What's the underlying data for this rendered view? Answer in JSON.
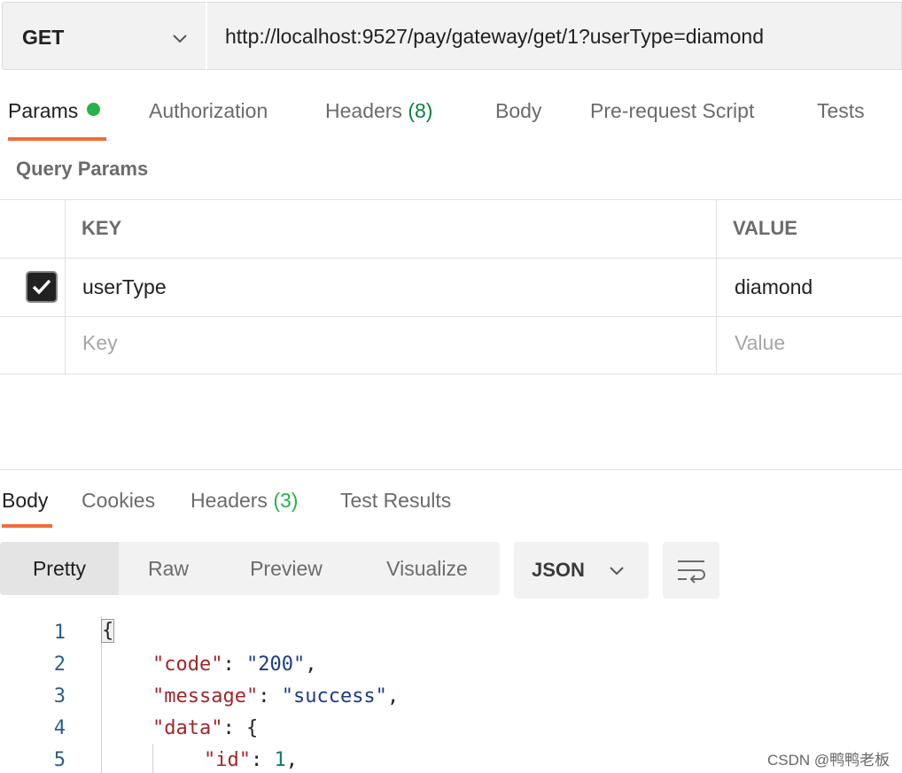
{
  "request": {
    "method": "GET",
    "url": "http://localhost:9527/pay/gateway/get/1?userType=diamond"
  },
  "request_tabs": [
    {
      "label": "Params",
      "active": true,
      "has_dot": true
    },
    {
      "label": "Authorization"
    },
    {
      "label": "Headers",
      "count": "(8)"
    },
    {
      "label": "Body"
    },
    {
      "label": "Pre-request Script"
    },
    {
      "label": "Tests"
    }
  ],
  "query_params": {
    "title": "Query Params",
    "columns": {
      "key": "KEY",
      "value": "VALUE"
    },
    "rows": [
      {
        "checked": true,
        "key": "userType",
        "value": "diamond"
      }
    ],
    "placeholder": {
      "key": "Key",
      "value": "Value"
    }
  },
  "response_tabs": [
    {
      "label": "Body",
      "active": true
    },
    {
      "label": "Cookies"
    },
    {
      "label": "Headers",
      "count": "(3)"
    },
    {
      "label": "Test Results"
    }
  ],
  "view_modes": [
    "Pretty",
    "Raw",
    "Preview",
    "Visualize"
  ],
  "active_view": "Pretty",
  "format": "JSON",
  "code_lines": [
    {
      "n": "1",
      "text": "{"
    },
    {
      "n": "2",
      "key": "\"code\"",
      "value": "\"200\"",
      "suffix": ","
    },
    {
      "n": "3",
      "key": "\"message\"",
      "value": "\"success\"",
      "suffix": ","
    },
    {
      "n": "4",
      "key": "\"data\"",
      "value": "{"
    },
    {
      "n": "5",
      "key": "\"id\"",
      "value": "1",
      "suffix": ","
    }
  ],
  "watermark": "CSDN @鸭鸭老板",
  "colors": {
    "accent": "#f26b3a",
    "dot": "#26b34a",
    "count": "#0a7f3f",
    "json_key": "#a1262a",
    "json_string": "#1b3b84",
    "json_number": "#0a7f6f"
  }
}
